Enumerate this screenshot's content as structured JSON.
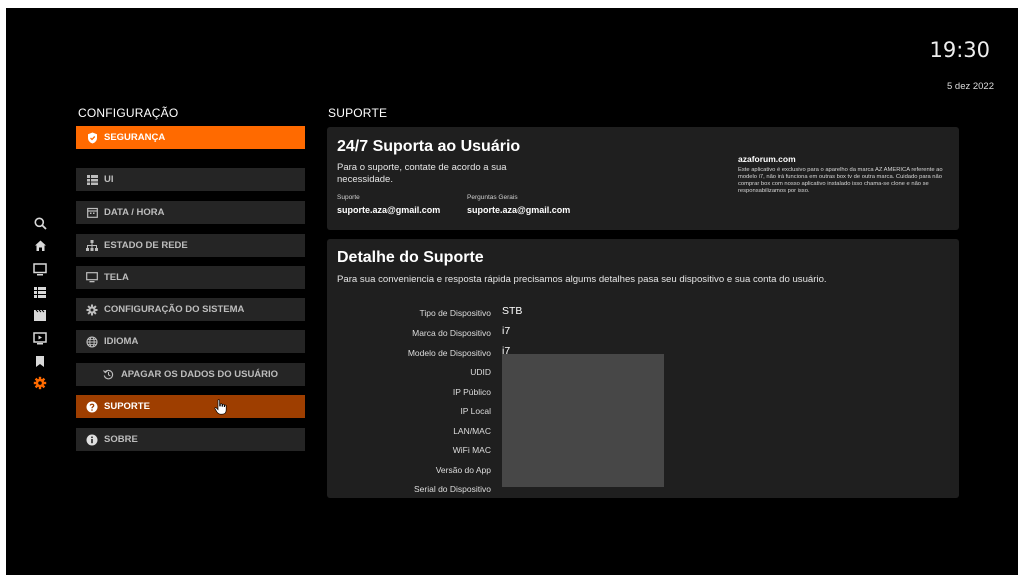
{
  "status": {
    "time": "19:30",
    "date": "5 dez 2022"
  },
  "rail_icons": [
    "search-icon",
    "home-icon",
    "tv-icon",
    "list-icon",
    "movies-icon",
    "series-icon",
    "bookmark-icon",
    "settings-icon"
  ],
  "config": {
    "title": "CONFIGURAÇÃO",
    "items": [
      {
        "label": "SEGURANÇA",
        "icon": "shield-icon",
        "state": "active"
      },
      {
        "label": "UI",
        "icon": "ui-icon",
        "state": "normal"
      },
      {
        "label": "DATA / HORA",
        "icon": "calendar-icon",
        "state": "normal"
      },
      {
        "label": "ESTADO DE REDE",
        "icon": "network-icon",
        "state": "normal"
      },
      {
        "label": "TELA",
        "icon": "monitor-icon",
        "state": "normal"
      },
      {
        "label": "CONFIGURAÇÃO DO SISTEMA",
        "icon": "gear-icon",
        "state": "normal"
      },
      {
        "label": "IDIOMA",
        "icon": "globe-icon",
        "state": "normal"
      },
      {
        "label": "APAGAR OS DADOS DO USUÁRIO",
        "icon": "reset-icon",
        "state": "normal"
      },
      {
        "label": "SUPORTE",
        "icon": "help-icon",
        "state": "focused"
      },
      {
        "label": "SOBRE",
        "icon": "info-icon",
        "state": "normal"
      }
    ]
  },
  "support": {
    "title": "SUPORTE",
    "card1": {
      "heading": "24/7 Suporta ao Usuário",
      "text": "Para o suporte, contate de acordo a sua necessidade.",
      "contacts": [
        {
          "label": "Suporte",
          "email": "suporte.aza@gmail.com"
        },
        {
          "label": "Perguntas Gerais",
          "email": "suporte.aza@gmail.com"
        }
      ],
      "site": "azaforum.com",
      "disclaimer": "Este aplicativo é exclusivo para o aparelho da marca AZ AMERICA referente ao modelo i7, não irá funciona em outras box tv de outra marca. Cuidado para não comprar box com nosso aplicativo instalado isso chama-se clone e não se responsabilizamos por isso."
    },
    "card2": {
      "heading": "Detalhe do Suporte",
      "text": "Para sua conveniencia e resposta rápida precisamos algums detalhes pasa seu dispositivo e sua conta do usuário.",
      "details": [
        {
          "label": "Tipo de Dispositivo",
          "value": "STB"
        },
        {
          "label": "Marca do Dispositivo",
          "value": "i7"
        },
        {
          "label": "Modelo de Dispositivo",
          "value": "i7"
        },
        {
          "label": "UDID",
          "value": ""
        },
        {
          "label": "IP Público",
          "value": ""
        },
        {
          "label": "IP Local",
          "value": ""
        },
        {
          "label": "LAN/MAC",
          "value": ""
        },
        {
          "label": "WiFi MAC",
          "value": ""
        },
        {
          "label": "Versão do App",
          "value": ""
        },
        {
          "label": "Serial do Dispositivo",
          "value": ""
        }
      ]
    }
  },
  "colors": {
    "accent": "#ff6a00",
    "focused": "#9e3e00",
    "card": "#1f1f1f",
    "item": "#252525"
  }
}
